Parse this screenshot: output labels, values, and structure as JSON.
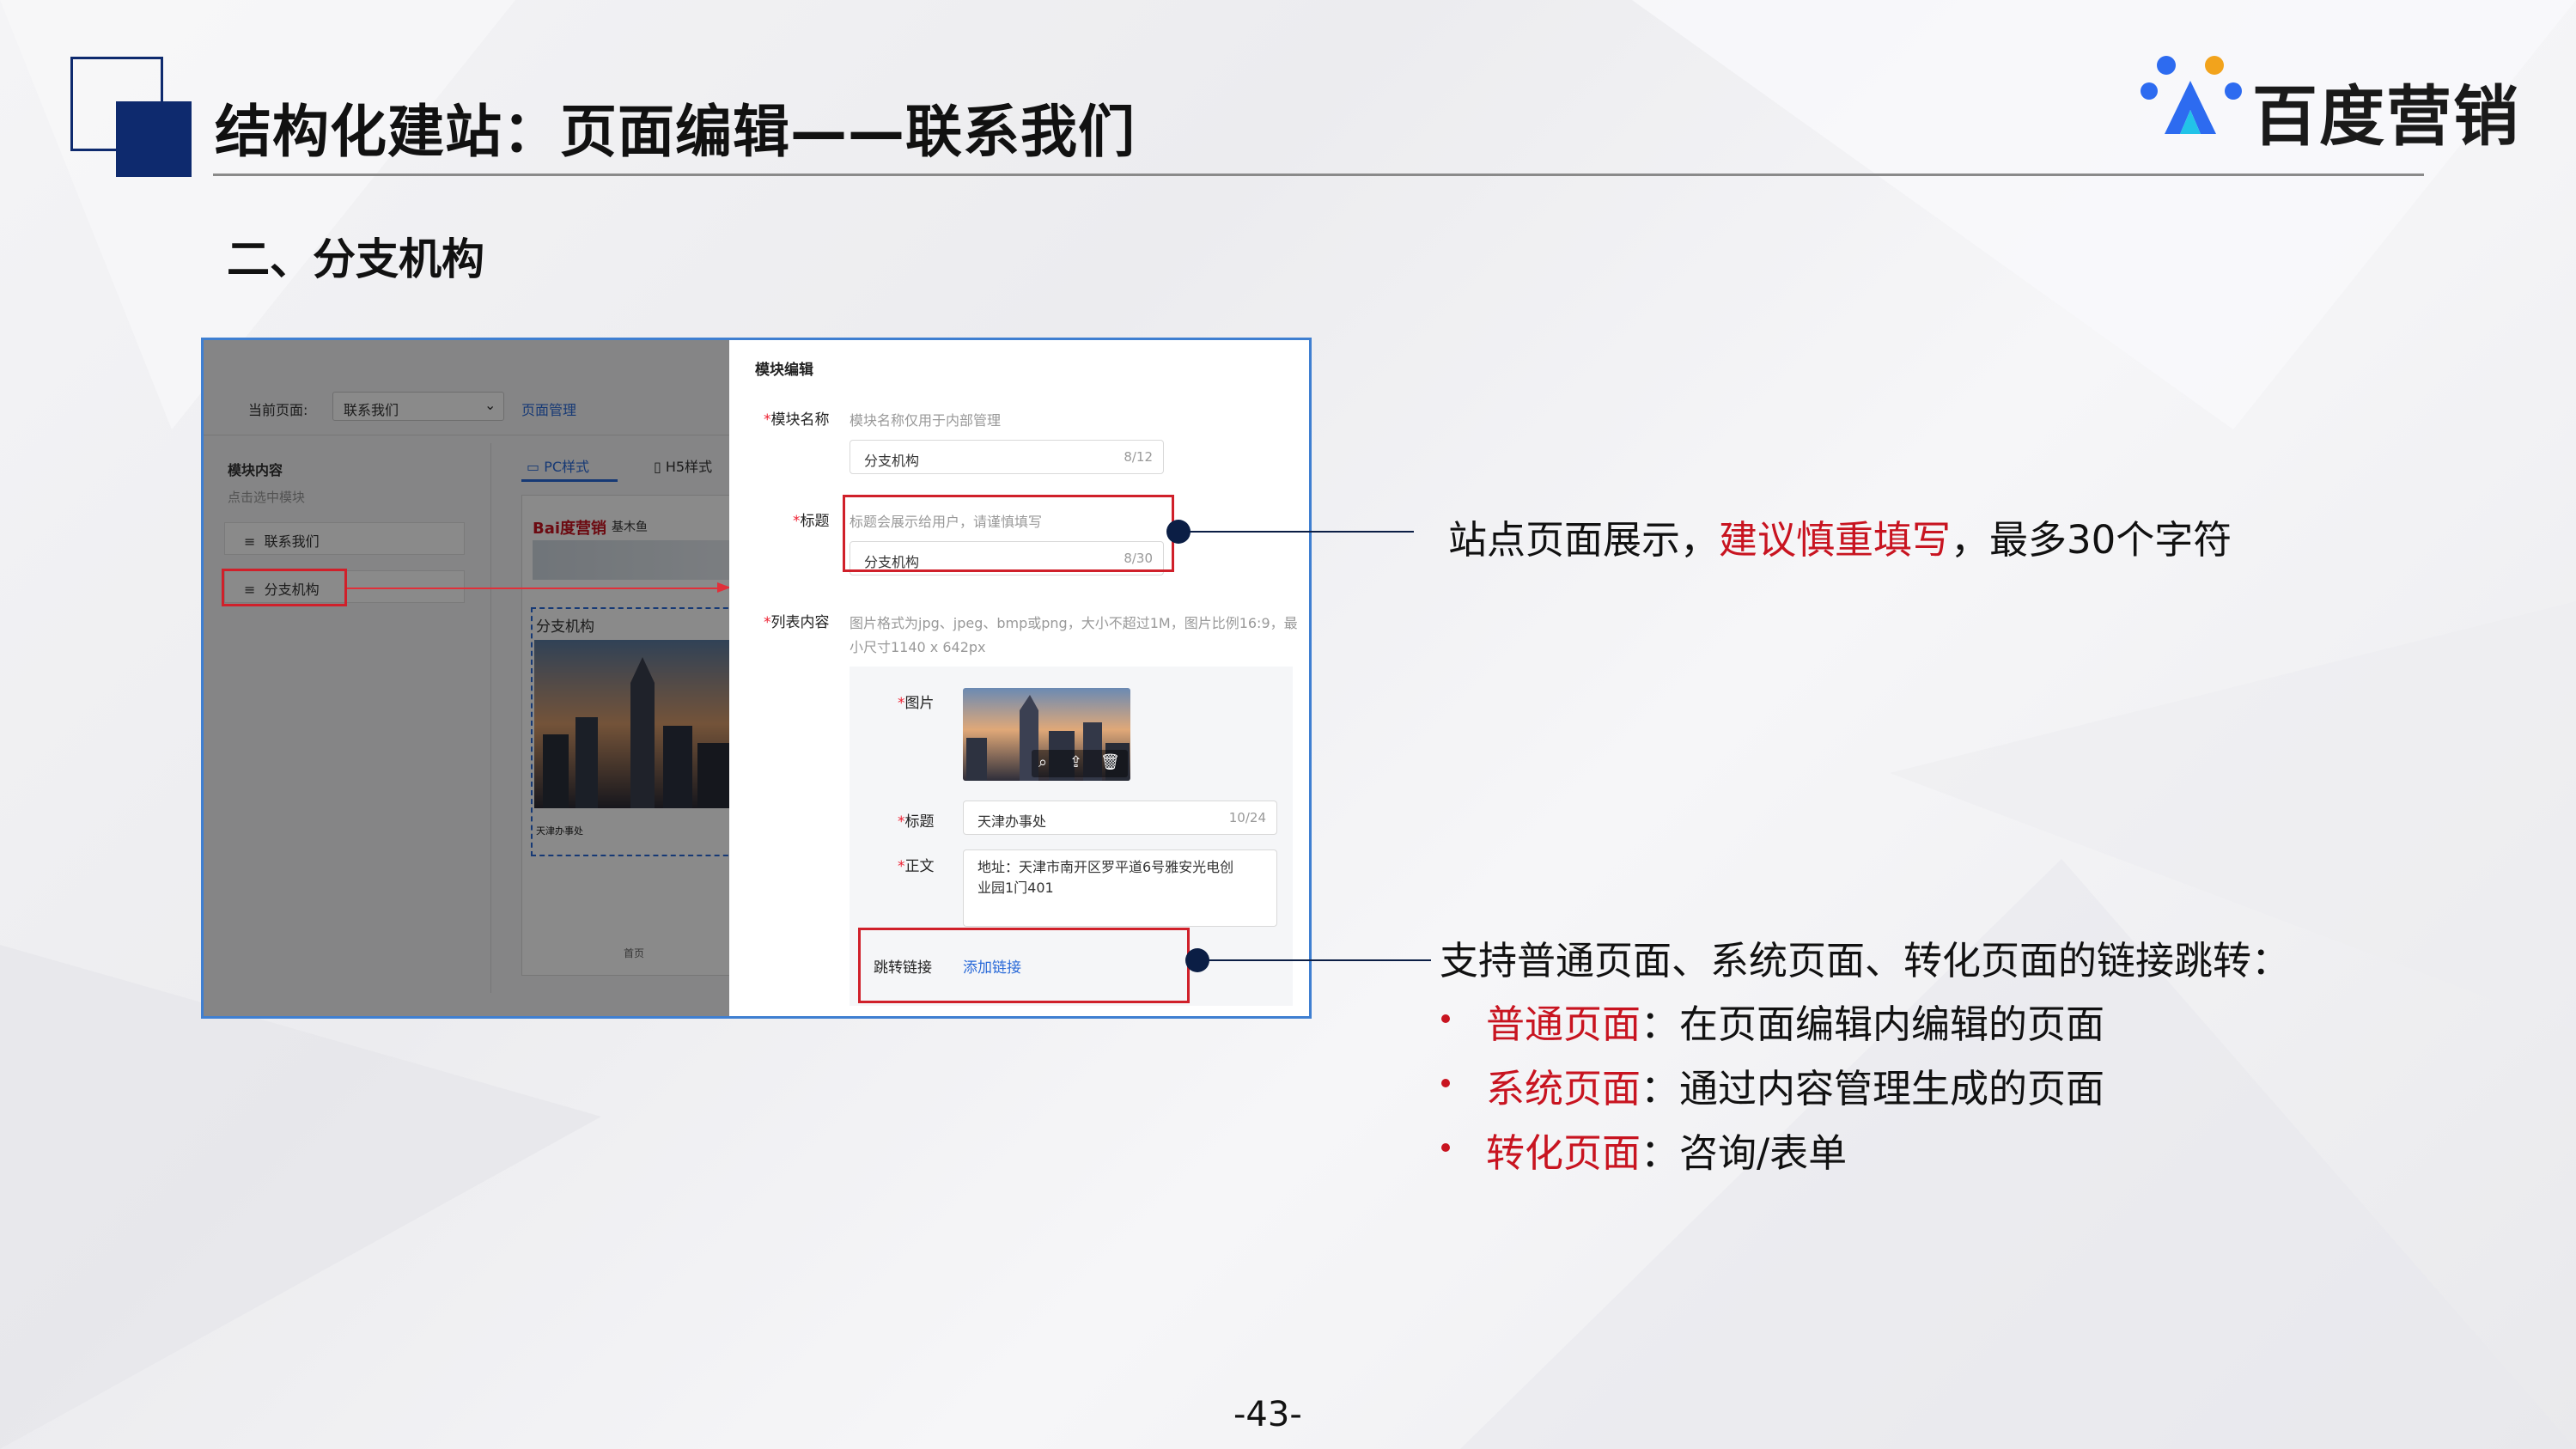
{
  "header": {
    "title": "结构化建站：页面编辑——联系我们",
    "logo_text": "百度营销",
    "section_title": "二、分支机构"
  },
  "screenshot": {
    "left_panel": {
      "current_page_label": "当前页面:",
      "current_page_value": "联系我们",
      "page_manage_link": "页面管理",
      "module_content_label": "模块内容",
      "module_hint": "点击选中模块",
      "nav_items": [
        "联系我们",
        "分支机构"
      ],
      "tab_pc": "PC样式",
      "tab_h5": "H5样式",
      "preview_brand": "Bai度营销",
      "preview_brand_suffix": "基木鱼",
      "preview_section_title": "分支机构",
      "preview_caption": "天津办事处",
      "preview_footer": "首页"
    },
    "right_panel": {
      "heading": "模块编辑",
      "module_name_label": "模块名称",
      "module_name_hint": "模块名称仅用于内部管理",
      "module_name_value": "分支机构",
      "module_name_count": "8/12",
      "title_label": "标题",
      "title_hint": "标题会展示给用户，请谨慎填写",
      "title_value": "分支机构",
      "title_count": "8/30",
      "list_label": "列表内容",
      "list_hint_1": "图片格式为jpg、jpeg、bmp或png，大小不超过1M，图片比例16:9，最",
      "list_hint_2": "小尺寸1140 x 642px",
      "image_label": "图片",
      "item_title_label": "标题",
      "item_title_value": "天津办事处",
      "item_title_count": "10/24",
      "body_label": "正文",
      "body_value_1": "地址：天津市南开区罗平道6号雅安光电创",
      "body_value_2": "业园1门401",
      "jump_link_label": "跳转链接",
      "add_link": "添加链接"
    }
  },
  "annotations": {
    "title_note_prefix": "站点页面展示，",
    "title_note_highlight": "建议慎重填写",
    "title_note_suffix": "，最多30个字符",
    "link_note": "支持普通页面、系统页面、转化页面的链接跳转：",
    "bullets": [
      {
        "term": "普通页面",
        "desc": "：在页面编辑内编辑的页面"
      },
      {
        "term": "系统页面",
        "desc": "：通过内容管理生成的页面"
      },
      {
        "term": "转化页面",
        "desc": "：咨询/表单"
      }
    ]
  },
  "footer": {
    "page_number": "-43-"
  },
  "colors": {
    "accent_navy": "#0e2a6e",
    "highlight_red": "#c81420",
    "link_blue": "#2a6ad8",
    "frame_blue": "#3f7fd1"
  }
}
